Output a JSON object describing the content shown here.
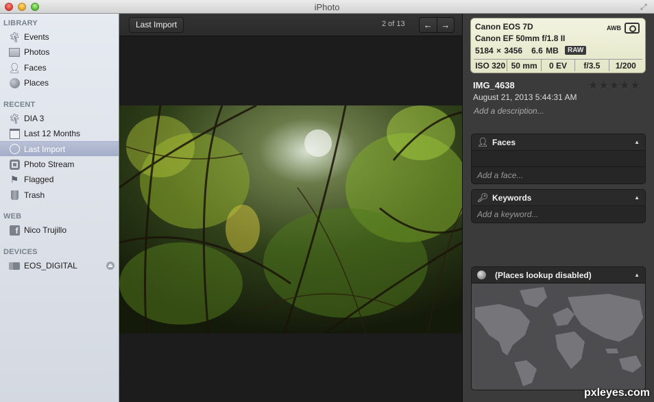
{
  "window": {
    "title": "iPhoto"
  },
  "sidebar": {
    "sections": [
      {
        "header": "LIBRARY",
        "items": [
          {
            "label": "Events",
            "icon": "palm-tree-icon"
          },
          {
            "label": "Photos",
            "icon": "photo-frame-icon"
          },
          {
            "label": "Faces",
            "icon": "person-icon"
          },
          {
            "label": "Places",
            "icon": "globe-icon"
          }
        ]
      },
      {
        "header": "RECENT",
        "items": [
          {
            "label": "DIA 3",
            "icon": "palm-tree-icon"
          },
          {
            "label": "Last 12 Months",
            "icon": "calendar-icon"
          },
          {
            "label": "Last Import",
            "icon": "clock-icon",
            "selected": true
          },
          {
            "label": "Photo Stream",
            "icon": "photo-stream-icon"
          },
          {
            "label": "Flagged",
            "icon": "flag-icon"
          },
          {
            "label": "Trash",
            "icon": "trash-icon"
          }
        ]
      },
      {
        "header": "WEB",
        "items": [
          {
            "label": "Nico Trujillo",
            "icon": "facebook-icon"
          }
        ]
      },
      {
        "header": "DEVICES",
        "items": [
          {
            "label": "EOS_DIGITAL",
            "icon": "camera-icon"
          }
        ]
      }
    ]
  },
  "toolbar": {
    "back_label": "Last Import",
    "counter": "2 of 13",
    "prev_icon": "←",
    "next_icon": "→"
  },
  "info": {
    "camera": "Canon EOS 7D",
    "lens": "Canon EF 50mm f/1.8 II",
    "dimensions": "5184 × 3456",
    "filesize": "6.6 MB",
    "format": "RAW",
    "white_balance": "AWB",
    "exposure": [
      "ISO 320",
      "50 mm",
      "0 EV",
      "f/3.5",
      "1/200"
    ],
    "name": "IMG_4638",
    "date": "August 21, 2013 5:44:31 AM",
    "description_placeholder": "Add a description...",
    "rating": 0,
    "stars": "★★★★★",
    "faces": {
      "title": "Faces",
      "add": "Add a face..."
    },
    "keywords": {
      "title": "Keywords",
      "add": "Add a keyword..."
    },
    "places": {
      "title": "(Places lookup disabled)"
    }
  },
  "watermark": "pxleyes.com"
}
